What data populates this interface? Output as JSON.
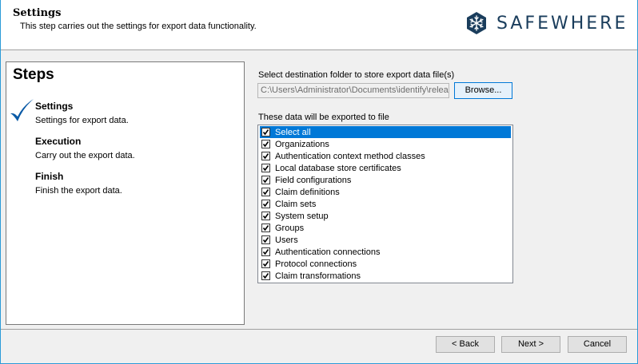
{
  "header": {
    "title": "Settings",
    "subtitle": "This step carries out the settings for export data functionality.",
    "logo_text": "SAFEWHERE",
    "logo_color": "#1a3d5c"
  },
  "steps": {
    "title": "Steps",
    "items": [
      {
        "name": "Settings",
        "desc": "Settings for export data.",
        "done": true
      },
      {
        "name": "Execution",
        "desc": "Carry out the export data.",
        "done": false
      },
      {
        "name": "Finish",
        "desc": "Finish the export data.",
        "done": false
      }
    ],
    "check_color": "#0a5aa6"
  },
  "destination": {
    "label": "Select destination folder to store export data file(s)",
    "path": "C:\\Users\\Administrator\\Documents\\identify\\release",
    "browse_label": "Browse..."
  },
  "export_list": {
    "label": "These data will be exported to file",
    "items": [
      {
        "label": "Select all",
        "checked": true,
        "selected": true
      },
      {
        "label": "Organizations",
        "checked": true
      },
      {
        "label": "Authentication context method classes",
        "checked": true
      },
      {
        "label": "Local database store certificates",
        "checked": true
      },
      {
        "label": "Field configurations",
        "checked": true
      },
      {
        "label": "Claim definitions",
        "checked": true
      },
      {
        "label": "Claim sets",
        "checked": true
      },
      {
        "label": "System setup",
        "checked": true
      },
      {
        "label": "Groups",
        "checked": true
      },
      {
        "label": "Users",
        "checked": true
      },
      {
        "label": "Authentication connections",
        "checked": true
      },
      {
        "label": "Protocol connections",
        "checked": true
      },
      {
        "label": "Claim transformations",
        "checked": true
      }
    ]
  },
  "footer": {
    "back_label": "< Back",
    "next_label": "Next >",
    "cancel_label": "Cancel"
  }
}
